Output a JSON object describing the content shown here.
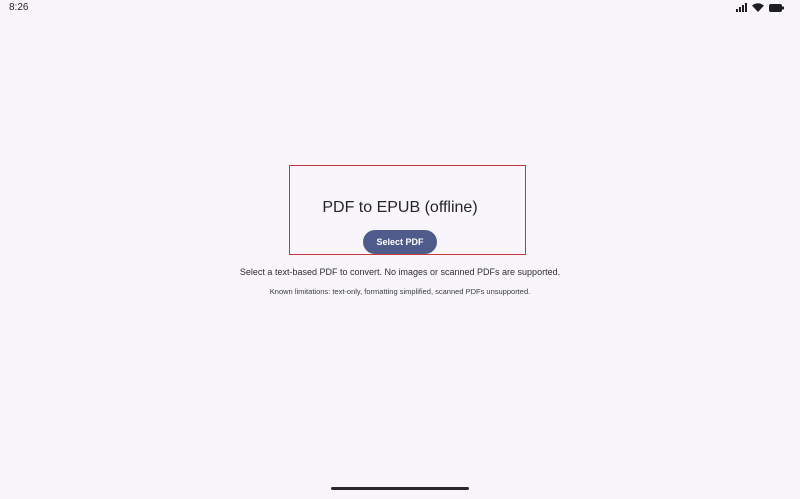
{
  "status_bar": {
    "time": "8:26",
    "icons": [
      "signal-icon",
      "wifi-icon",
      "battery-icon"
    ]
  },
  "main": {
    "title": "PDF to EPUB (offline)",
    "select_button_label": "Select PDF",
    "instructions": "Select a text-based PDF to convert. No images or scanned PDFs are supported.",
    "limitations": "Known limitations: text-only, formatting simplified, scanned PDFs unsupported."
  },
  "colors": {
    "background": "#f8f6fa",
    "button": "#4f5b8b",
    "highlight_border": "#c8383a"
  }
}
